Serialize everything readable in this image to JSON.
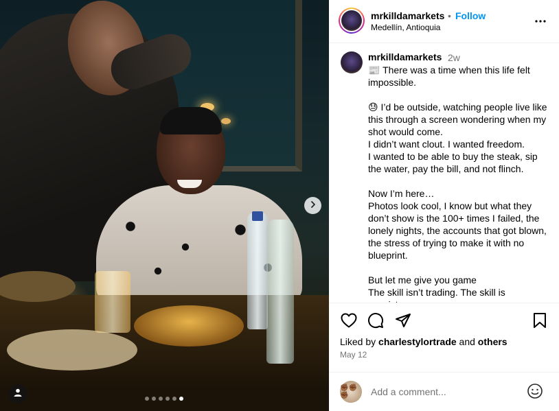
{
  "post": {
    "username": "mrkilldamarkets",
    "follow_label": "Follow",
    "dot": "•",
    "location": "Medellín, Antioquia",
    "more_icon": "more-horizontal-icon"
  },
  "carousel": {
    "slide_count": 6,
    "active_index": 5,
    "next_icon": "chevron-right-icon",
    "tag_icon": "user-tag-icon"
  },
  "caption": {
    "username": "mrkilldamarkets",
    "time": "2w",
    "text": "📰 There was a time when this life felt impossible.\n\n😓 I’d be outside, watching people live like this through a screen wondering when my shot would come.\nI didn’t want clout. I wanted freedom.\nI wanted to be able to buy the steak, sip the water, pay the bill, and not flinch.\n\nNow I’m here…\nPhotos look cool, I know but what they don’t show is the 100+ times I failed, the lonely nights, the accounts that got blown, the stress of trying to make it with no blueprint.\n\nBut let me give you game\nThe skill isn’t trading. The skill is consistency."
  },
  "actions": {
    "like_icon": "heart-icon",
    "comment_icon": "comment-icon",
    "share_icon": "share-icon",
    "save_icon": "bookmark-icon",
    "liked_by_prefix": "Liked by ",
    "liked_by_user": "charlestylortrade",
    "liked_by_and": " and ",
    "liked_by_others": "others",
    "date": "May 12"
  },
  "comment": {
    "placeholder": "Add a comment...",
    "avatar_glyph": "✊🏾✊🏾✊🏾",
    "emoji_icon": "smiley-icon"
  },
  "colors": {
    "accent": "#0095f6",
    "secondary_text": "#737373",
    "divider": "#efefef"
  }
}
